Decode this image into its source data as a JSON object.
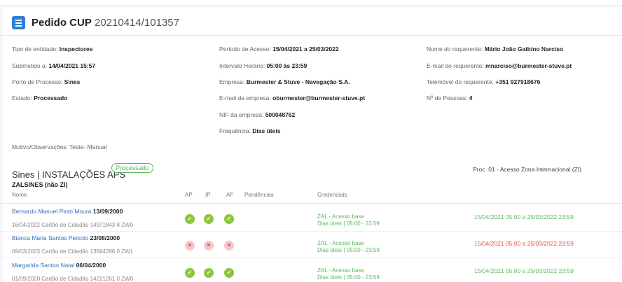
{
  "header": {
    "title": "Pedido CUP",
    "id": "20210414/101357"
  },
  "details": {
    "col1": [
      {
        "label": "Tipo de entidade:",
        "value": "Inspectores"
      },
      {
        "label": "Submetido a:",
        "value": "14/04/2021 15:57"
      },
      {
        "label": "Porto de Processo:",
        "value": "Sines"
      },
      {
        "label": "Estado:",
        "value": "Processado"
      }
    ],
    "col2": [
      {
        "label": "Período de Acesso:",
        "value": "15/04/2021 a 25/03/2022"
      },
      {
        "label": "Intervalo Horário:",
        "value": "05:00 às 23:59"
      },
      {
        "label": "Empresa:",
        "value": "Burmester & Stuve - Navegação S.A."
      },
      {
        "label": "E-mail da empresa:",
        "value": "oburmester@burmester-stuve.pt"
      },
      {
        "label": "NIF da empresa:",
        "value": "500048762"
      },
      {
        "label": "Frequência:",
        "value": "Dias úteis"
      }
    ],
    "col3": [
      {
        "label": "Nome do requerente:",
        "value": "Mário João Gaibino Narciso"
      },
      {
        "label": "E-mail do requerente:",
        "value": "mnarciso@burmester-stuve.pt"
      },
      {
        "label": "Telemóvel do requerente:",
        "value": "+351 927918676"
      },
      {
        "label": "Nº de Pessoas:",
        "value": "4"
      }
    ],
    "motivo": "Motivo/Observações: Teste- Manual"
  },
  "section": {
    "title": "Sines | INSTALAÇÕES APS",
    "badge": "Processado",
    "subtitle": "ZALSINES (não ZI)",
    "proc": "Proc. 01 - Acesso Zona Internacional (ZI)"
  },
  "table": {
    "headers": {
      "nome": "Nome",
      "ap": "AP",
      "ip": "IP",
      "af": "AF",
      "pend": "Pendências",
      "cred": "Credenciais"
    },
    "rows": [
      {
        "name": "Bernardo Manuel Pinto Moura",
        "dob": "13/09/2000",
        "meta": "16/04/2022   Cartão de Cidadão   14971843 8 ZW0",
        "status": "ok",
        "cred1": "ZAL - Acesso base",
        "cred2": "Dias úteis | 05:00 - 23:59",
        "validity": "15/04/2021 05:00  a  25/03/2022 23:59",
        "validity_color": "#5cb85c"
      },
      {
        "name": "Bianca Maria Santos Peixoto",
        "dob": "23/08/2000",
        "meta": "09/03/2023   Cartão de Cidadão   13684286 0 ZW1",
        "status": "no",
        "cred1": "ZAL - Acesso base",
        "cred2": "Dias úteis | 05:00 - 23:59",
        "validity": "15/04/2021 05:00  a  25/03/2022 23:59",
        "validity_color": "#d9534f"
      },
      {
        "name": "Margarida Santos Natal",
        "dob": "06/04/2000",
        "meta": "01/09/2020   Cartão de Cidadão   14221261 0 ZW0",
        "status": "ok",
        "cred1": "ZAL - Acesso base",
        "cred2": "Dias úteis | 05:00 - 23:59",
        "validity": "15/04/2021 05:00  a  25/03/2022 23:59",
        "validity_color": "#5cb85c"
      }
    ]
  },
  "icons": {
    "ok": "check-icon",
    "no": "cross-icon"
  },
  "glyphs": {
    "ok": "✓",
    "no": "✕"
  }
}
